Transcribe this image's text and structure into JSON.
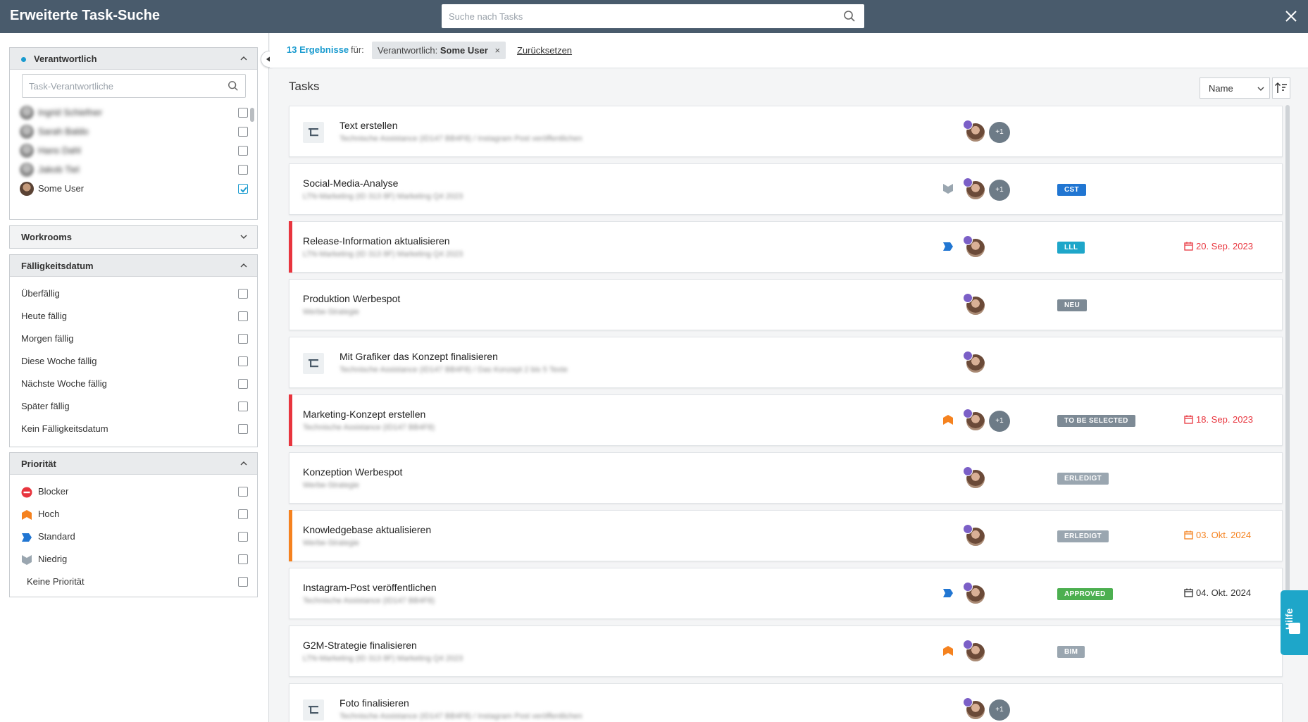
{
  "header": {
    "title": "Erweiterte Task-Suche",
    "search_placeholder": "Suche nach Tasks",
    "close_icon": "close-icon"
  },
  "filters": {
    "responsible": {
      "title": "Verantwortlich",
      "search_placeholder": "Task-Verantwortliche",
      "users": [
        {
          "name": "Ingrid Schiefner",
          "checked": false
        },
        {
          "name": "Sarah Baldo",
          "checked": false
        },
        {
          "name": "Hans Dahl",
          "checked": false
        },
        {
          "name": "Jakob Tiel",
          "checked": false
        },
        {
          "name": "Some User",
          "checked": true
        }
      ]
    },
    "workrooms": {
      "title": "Workrooms"
    },
    "due": {
      "title": "Fälligkeitsdatum",
      "options": [
        "Überfällig",
        "Heute fällig",
        "Morgen fällig",
        "Diese Woche fällig",
        "Nächste Woche fällig",
        "Später fällig",
        "Kein Fälligkeitsdatum"
      ]
    },
    "priority": {
      "title": "Priorität",
      "options": [
        {
          "label": "Blocker",
          "icon": "blocker-icon",
          "color": "#e8353e"
        },
        {
          "label": "Hoch",
          "icon": "high-priority-icon",
          "color": "#f5821f"
        },
        {
          "label": "Standard",
          "icon": "standard-priority-icon",
          "color": "#2176d2"
        },
        {
          "label": "Niedrig",
          "icon": "low-priority-icon",
          "color": "#9aa6b0"
        },
        {
          "label": "Keine Priorität",
          "icon": "",
          "color": ""
        }
      ]
    }
  },
  "results": {
    "count": "13 Ergebnisse",
    "for": "für:",
    "chip_key": "Verantwortlich:",
    "chip_value": "Some User",
    "chip_remove": "×",
    "reset": "Zurücksetzen"
  },
  "tasks_panel": {
    "title": "Tasks",
    "sort_value": "Name"
  },
  "tasks": [
    {
      "name": "Text erstellen",
      "sub": "Technische Assistance (ID147 BB4F8) / Instagram Post veröffentlichen",
      "icon": true,
      "prio": "",
      "extra": "+1",
      "tag": "",
      "tag_color": "",
      "due": "",
      "due_color": "",
      "stripe": ""
    },
    {
      "name": "Social-Media-Analyse",
      "sub": "LTN-Marketing (ID 313 8F) Marketing Q4 2023",
      "icon": false,
      "prio": "low",
      "extra": "+1",
      "tag": "CST",
      "tag_color": "#2176d2",
      "due": "",
      "due_color": "",
      "stripe": ""
    },
    {
      "name": "Release-Information aktualisieren",
      "sub": "LTN-Marketing (ID 313 8F) Marketing Q4 2023",
      "icon": false,
      "prio": "standard",
      "extra": "",
      "tag": "LLL",
      "tag_color": "#1ea6c9",
      "due": "20. Sep. 2023",
      "due_color": "#e8353e",
      "stripe": "red"
    },
    {
      "name": "Produktion Werbespot",
      "sub": "Werbe-Strategie",
      "icon": false,
      "prio": "",
      "extra": "",
      "tag": "NEU",
      "tag_color": "#7d8a95",
      "due": "",
      "due_color": "",
      "stripe": ""
    },
    {
      "name": "Mit Grafiker das Konzept finalisieren",
      "sub": "Technische Assistance (ID147 BB4F8) / Das Konzept 2 bis 5 Texte",
      "icon": true,
      "prio": "",
      "extra": "",
      "tag": "",
      "tag_color": "",
      "due": "",
      "due_color": "",
      "stripe": ""
    },
    {
      "name": "Marketing-Konzept erstellen",
      "sub": "Technische Assistance (ID147 BB4F8)",
      "icon": false,
      "prio": "high",
      "extra": "+1",
      "tag": "TO BE SELECTED",
      "tag_color": "#7d8a95",
      "due": "18. Sep. 2023",
      "due_color": "#e8353e",
      "stripe": "red"
    },
    {
      "name": "Konzeption Werbespot",
      "sub": "Werbe-Strategie",
      "icon": false,
      "prio": "",
      "extra": "",
      "tag": "ERLEDIGT",
      "tag_color": "#9aa6b0",
      "due": "",
      "due_color": "",
      "stripe": ""
    },
    {
      "name": "Knowledgebase aktualisieren",
      "sub": "Werbe-Strategie",
      "icon": false,
      "prio": "",
      "extra": "",
      "tag": "ERLEDIGT",
      "tag_color": "#9aa6b0",
      "due": "03. Okt. 2024",
      "due_color": "#f5821f",
      "stripe": "orange"
    },
    {
      "name": "Instagram-Post veröffentlichen",
      "sub": "Technische Assistance (ID147 BB4F8)",
      "icon": false,
      "prio": "standard",
      "extra": "",
      "tag": "APPROVED",
      "tag_color": "#4caf50",
      "due": "04. Okt. 2024",
      "due_color": "#333333",
      "stripe": ""
    },
    {
      "name": "G2M-Strategie finalisieren",
      "sub": "LTN-Marketing (ID 313 8F) Marketing Q4 2023",
      "icon": false,
      "prio": "high",
      "extra": "",
      "tag": "BIM",
      "tag_color": "#9aa6b0",
      "due": "",
      "due_color": "",
      "stripe": ""
    },
    {
      "name": "Foto finalisieren",
      "sub": "Technische Assistance (ID147 BB4F8) / Instagram Post veröffentlichen",
      "icon": true,
      "prio": "",
      "extra": "+1",
      "tag": "",
      "tag_color": "",
      "due": "",
      "due_color": "",
      "stripe": ""
    }
  ],
  "help": {
    "label": "Hilfe"
  }
}
